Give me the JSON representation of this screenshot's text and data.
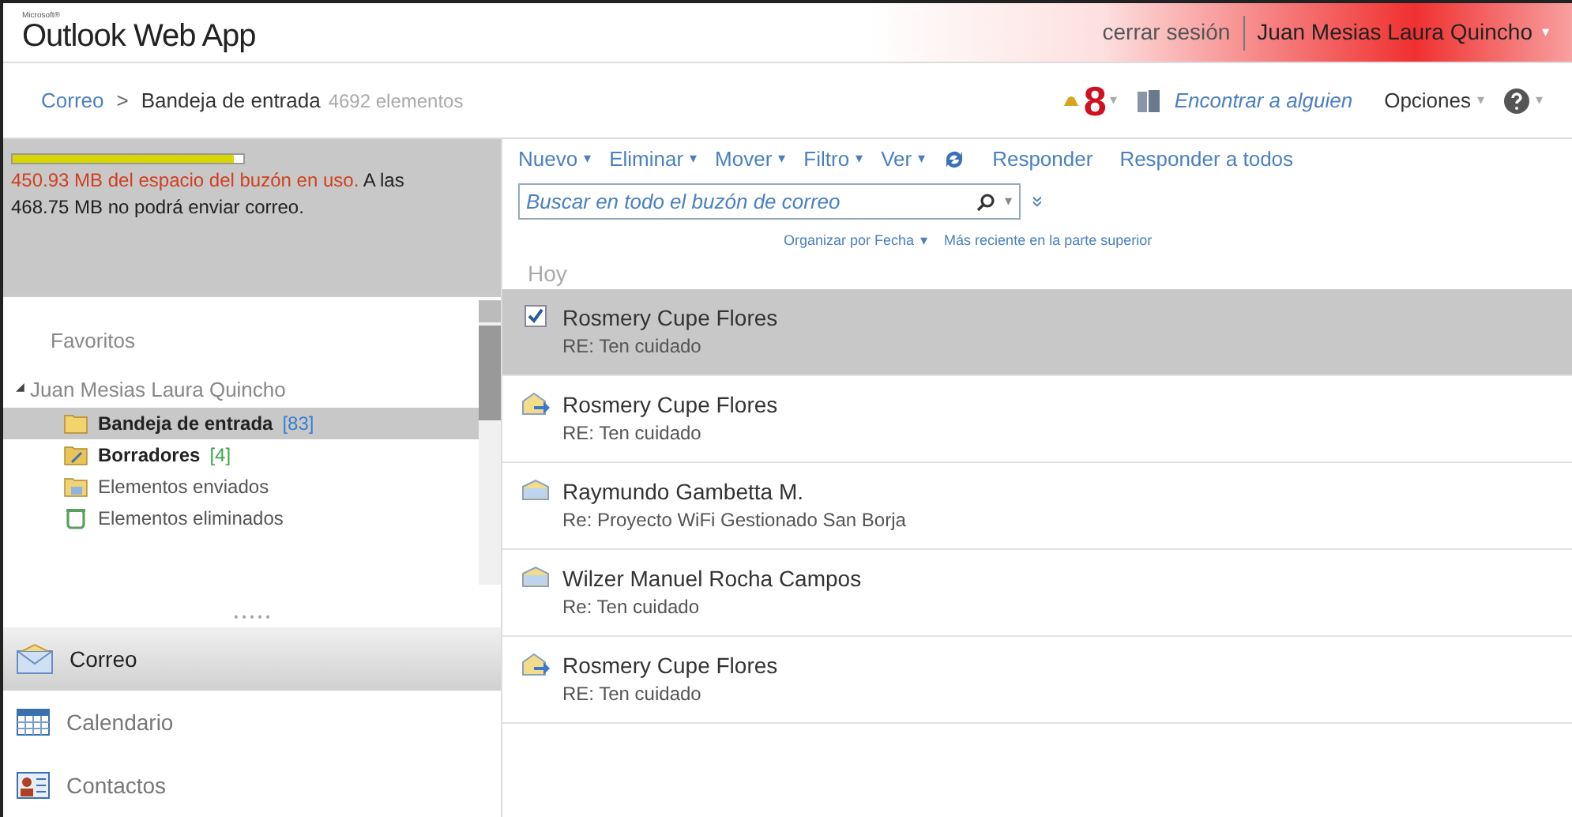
{
  "header": {
    "brand_small": "Microsoft®",
    "brand": "Outlook Web App",
    "signout": "cerrar sesión",
    "user": "Juan Mesias Laura Quincho",
    "user_caret": "▾"
  },
  "breadcrumb": {
    "root": "Correo",
    "separator": ">",
    "folder": "Bandeja de entrada",
    "count": "4692 elementos"
  },
  "top_actions": {
    "reminders": "8",
    "caret": "▾",
    "find": "Encontrar a alguien",
    "options": "Opciones",
    "options_caret": "▾",
    "help_caret": "▾"
  },
  "quota": {
    "level": 0.96,
    "warning": "450.93 MB del espacio del buzón en uso.",
    "note": " A las 468.75 MB no podrá enviar correo."
  },
  "sidebar": {
    "favorites": "Favoritos",
    "mailbox": {
      "name": "Juan Mesias Laura Quincho",
      "expanded": true,
      "expander": "◢",
      "folders": [
        {
          "name": "Bandeja de entrada",
          "kind": "inbox",
          "bold": true,
          "count": "[83]",
          "color": "#3a7fd0",
          "selected": true
        },
        {
          "name": "Borradores",
          "kind": "drafts",
          "bold": true,
          "count": "[4]",
          "color": "#3aa84a",
          "selected": false
        },
        {
          "name": "Elementos enviados",
          "kind": "sent",
          "bold": false,
          "selected": false
        },
        {
          "name": "Elementos eliminados",
          "kind": "deleted",
          "bold": false,
          "selected": false
        }
      ]
    },
    "splitter": "• • • • •",
    "nav": [
      {
        "label": "Correo",
        "kind": "mail",
        "selected": true
      },
      {
        "label": "Calendario",
        "kind": "calendar",
        "selected": false
      },
      {
        "label": "Contactos",
        "kind": "contacts",
        "selected": false
      }
    ]
  },
  "toolbar": {
    "menus": [
      {
        "label": "Nuevo",
        "caret": "▾"
      },
      {
        "label": "Eliminar",
        "caret": "▾"
      },
      {
        "label": "Mover",
        "caret": "▾"
      },
      {
        "label": "Filtro",
        "caret": "▾"
      },
      {
        "label": "Ver",
        "caret": "▾"
      }
    ],
    "actions": [
      "Responder",
      "Responder a todos"
    ]
  },
  "search": {
    "placeholder": "Buscar en todo el buzón de correo",
    "caret": "▾",
    "expand": "»"
  },
  "sort": {
    "arrange": "Organizar por Fecha",
    "arrange_caret": "▾",
    "order": "Más reciente en la parte superior"
  },
  "messages": {
    "group": "Hoy",
    "items": [
      {
        "sender": "Rosmery Cupe Flores",
        "subject": "RE: Ten cuidado",
        "selected": true
      },
      {
        "sender": "Rosmery Cupe Flores",
        "subject": "RE: Ten cuidado",
        "kind": "replied",
        "selected": false
      },
      {
        "sender": "Raymundo Gambetta M.",
        "subject": "Re: Proyecto WiFi Gestionado San Borja",
        "kind": "read",
        "selected": false
      },
      {
        "sender": "Wilzer Manuel Rocha Campos",
        "subject": "Re: Ten cuidado",
        "kind": "read",
        "selected": false
      },
      {
        "sender": "Rosmery Cupe Flores",
        "subject": "RE: Ten cuidado",
        "kind": "replied",
        "selected": false
      }
    ]
  }
}
